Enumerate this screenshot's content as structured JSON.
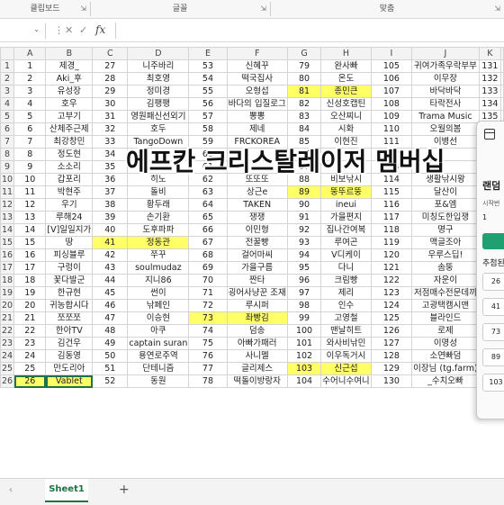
{
  "ribbon": {
    "groups": [
      {
        "label": "클립보드"
      },
      {
        "label": "글꼴"
      },
      {
        "label": "맞춤"
      }
    ]
  },
  "formula_bar": {
    "name_box": "",
    "fx": "fx",
    "value": ""
  },
  "columns": [
    "A",
    "B",
    "C",
    "D",
    "E",
    "F",
    "G",
    "H",
    "I",
    "J",
    "K"
  ],
  "rows": [
    [
      "1",
      "제경_",
      "27",
      "니주바리",
      "53",
      "신혜꾸",
      "79",
      "완사빠",
      "105",
      "귀여가족우락부부",
      "131"
    ],
    [
      "2",
      "Aki_후",
      "28",
      "최호영",
      "54",
      "떡국집사",
      "80",
      "온도",
      "106",
      "이무장",
      "132"
    ],
    [
      "3",
      "유성장",
      "29",
      "정미경",
      "55",
      "오형섭",
      "81",
      "종민큰",
      "107",
      "바닥바닥",
      "133"
    ],
    [
      "4",
      "호우",
      "30",
      "김팽팽",
      "56",
      "바다의 입질로그",
      "82",
      "신성호캡틴",
      "108",
      "타락전사",
      "134"
    ],
    [
      "5",
      "고부기",
      "31",
      "영원패신선외기",
      "57",
      "뽕뽕",
      "83",
      "오산찌니",
      "109",
      "Trama Music",
      "135"
    ],
    [
      "6",
      "산체주근제",
      "32",
      "호두",
      "58",
      "제네",
      "84",
      "시화",
      "110",
      "오월의봄",
      "136"
    ],
    [
      "7",
      "최강창민",
      "33",
      "TangoDown",
      "59",
      "FRCKOREA",
      "85",
      "이현진",
      "111",
      "이병선",
      "137"
    ],
    [
      "8",
      "정도현",
      "34",
      "",
      "60",
      "",
      "86",
      "",
      "112",
      "",
      "138"
    ],
    [
      "9",
      "소소리",
      "35",
      "",
      "61",
      "",
      "87",
      "",
      "113",
      "",
      "139"
    ],
    [
      "10",
      "갑포리",
      "36",
      "히노",
      "62",
      "또또또",
      "88",
      "비보낚시",
      "114",
      "생활낚시왕",
      "140"
    ],
    [
      "11",
      "박현주",
      "37",
      "돌비",
      "63",
      "상근e",
      "89",
      "뚱뚜르뚱",
      "115",
      "달산이",
      "141"
    ],
    [
      "12",
      "우기",
      "38",
      "황두래",
      "64",
      "TAKEN",
      "90",
      "ineui",
      "116",
      "포&엠",
      "142"
    ],
    [
      "13",
      "루해24",
      "39",
      "손기환",
      "65",
      "쟁쟁",
      "91",
      "가을편지",
      "117",
      "미칭도한입쟁",
      "143"
    ],
    [
      "14",
      "[V]일일지가",
      "40",
      "도후파파",
      "66",
      "이민형",
      "92",
      "집나간여복",
      "118",
      "명구",
      "144"
    ],
    [
      "15",
      "땅",
      "41",
      "정동관",
      "67",
      "전꿀빵",
      "93",
      "루여곤",
      "119",
      "맥글조아",
      "145"
    ],
    [
      "16",
      "피싱블루",
      "42",
      "쭈꾸",
      "68",
      "걸어마씨",
      "94",
      "V디케이",
      "120",
      "우루스딥!",
      "146"
    ],
    [
      "17",
      "구렁이",
      "43",
      "soulmudaz",
      "69",
      "가을구름",
      "95",
      "다니",
      "121",
      "솜뚱",
      "147"
    ],
    [
      "18",
      "꽃다발군",
      "44",
      "지니86",
      "70",
      "짠타",
      "96",
      "크림빵",
      "122",
      "자운이",
      "148"
    ],
    [
      "19",
      "한규현",
      "45",
      "썬이",
      "71",
      "굉어사냥꾼 조재",
      "97",
      "제리",
      "123",
      "저점매수전문데끼",
      "149"
    ],
    [
      "20",
      "귀농합시다",
      "46",
      "낚페인",
      "72",
      "루시퍼",
      "98",
      "인수",
      "124",
      "고광택캠시맨",
      "150"
    ],
    [
      "21",
      "쪼쪼쪼",
      "47",
      "이승현",
      "73",
      "좌빵김",
      "99",
      "고영철",
      "125",
      "블라인드",
      "151"
    ],
    [
      "22",
      "한아TV",
      "48",
      "아쿠",
      "74",
      "덤송",
      "100",
      "맨날히트",
      "126",
      "로제",
      "152"
    ],
    [
      "23",
      "김건우",
      "49",
      "captain suran",
      "75",
      "아빠가패러",
      "101",
      "와사비낚민",
      "127",
      "이명성",
      "153"
    ],
    [
      "24",
      "김동영",
      "50",
      "용연로주역",
      "76",
      "사니멜",
      "102",
      "이우독거시",
      "128",
      "소연빠덤",
      "154"
    ],
    [
      "25",
      "만도리아",
      "51",
      "단테니즘",
      "77",
      "글리제스",
      "103",
      "신근섭",
      "129",
      "이장님 (tg.farm)",
      "155"
    ],
    [
      "26",
      "Vablet",
      "52",
      "동원",
      "78",
      "떡돌이방랑자",
      "104",
      "수어니수여니",
      "130",
      "_수치오빠",
      "156"
    ]
  ],
  "highlights": [
    {
      "row": 3,
      "col": "G"
    },
    {
      "row": 3,
      "col": "H"
    },
    {
      "row": 11,
      "col": "G"
    },
    {
      "row": 11,
      "col": "H"
    },
    {
      "row": 15,
      "col": "C"
    },
    {
      "row": 15,
      "col": "D"
    },
    {
      "row": 21,
      "col": "E"
    },
    {
      "row": 21,
      "col": "F"
    },
    {
      "row": 25,
      "col": "G"
    },
    {
      "row": 25,
      "col": "H"
    },
    {
      "row": 26,
      "col": "A"
    },
    {
      "row": 26,
      "col": "B"
    }
  ],
  "banner": {
    "text": "에프칸 크리스탈레이저 멤버십"
  },
  "panel": {
    "title": "랜덤",
    "start_label": "시작번",
    "start_value": "1",
    "recommend_label": "추첨된",
    "numbers": [
      "26",
      "41",
      "73",
      "89",
      "103"
    ]
  },
  "sheet": {
    "name": "Sheet1",
    "add": "+",
    "prev": "‹"
  },
  "colors": {
    "highlight": "#ffff66",
    "accent": "#1f7244",
    "panel_button": "#20a070"
  }
}
